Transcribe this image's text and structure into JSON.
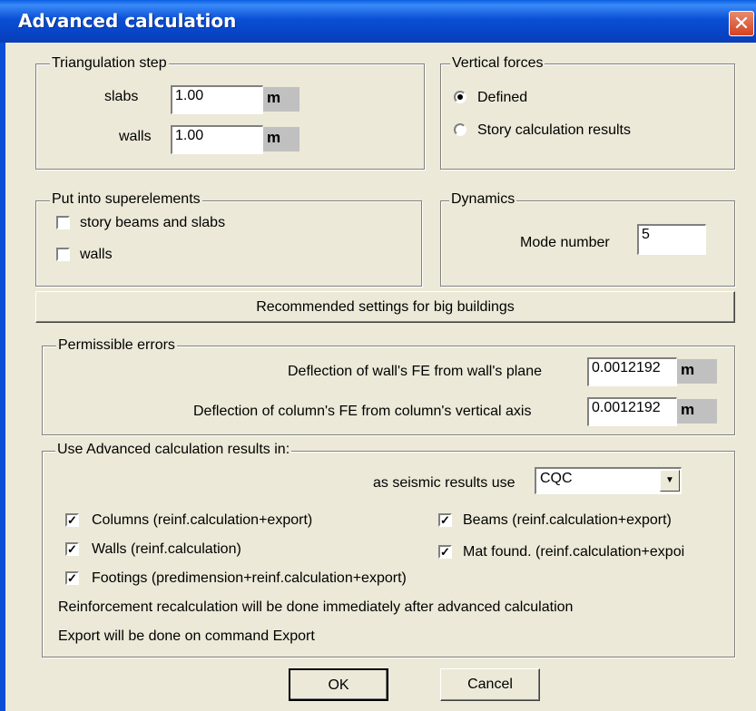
{
  "window": {
    "title": "Advanced calculation",
    "close_glyph": "✕"
  },
  "triangulation": {
    "label": "Triangulation step",
    "slabs_label": "slabs",
    "slabs_value": "1.00",
    "slabs_unit": "m",
    "walls_label": "walls",
    "walls_value": "1.00",
    "walls_unit": "m"
  },
  "vertical_forces": {
    "label": "Vertical forces",
    "option_defined": "Defined",
    "option_story": "Story calculation results",
    "selected": "Defined"
  },
  "superelements": {
    "label": "Put into superelements",
    "story_beams_label": "story beams and slabs",
    "story_beams_checked": false,
    "walls_label": "walls",
    "walls_checked": false
  },
  "dynamics": {
    "label": "Dynamics",
    "mode_label": "Mode number",
    "mode_value": "5"
  },
  "recommended_button": "Recommended settings for big buildings",
  "permissible_errors": {
    "label": "Permissible errors",
    "wall_label": "Deflection of wall's FE from wall's plane",
    "wall_value": "0.0012192",
    "wall_unit": "m",
    "column_label": "Deflection of column's FE from column's vertical axis",
    "column_value": "0.0012192",
    "column_unit": "m"
  },
  "advanced_results": {
    "label": "Use Advanced calculation results in:",
    "seismic_label": "as seismic results use",
    "seismic_value": "CQC",
    "columns_label": "Columns (reinf.calculation+export)",
    "columns_checked": true,
    "walls_label": "Walls (reinf.calculation)",
    "walls_checked": true,
    "footings_label": "Footings (predimension+reinf.calculation+export)",
    "footings_checked": true,
    "beams_label": "Beams (reinf.calculation+export)",
    "beams_checked": true,
    "mat_label": "Mat found. (reinf.calculation+expoi",
    "mat_checked": true,
    "note1": "Reinforcement recalculation will be done immediately after advanced calculation",
    "note2": "Export will be done on command Export"
  },
  "buttons": {
    "ok": "OK",
    "cancel": "Cancel"
  },
  "icons": {
    "check": "✓",
    "dropdown": "▼"
  },
  "colors": {
    "titlebar": "#0a4fd6",
    "dialog_bg": "#ece9d8",
    "unit_bg": "#c0c0c0",
    "close_btn": "#d3411f"
  }
}
